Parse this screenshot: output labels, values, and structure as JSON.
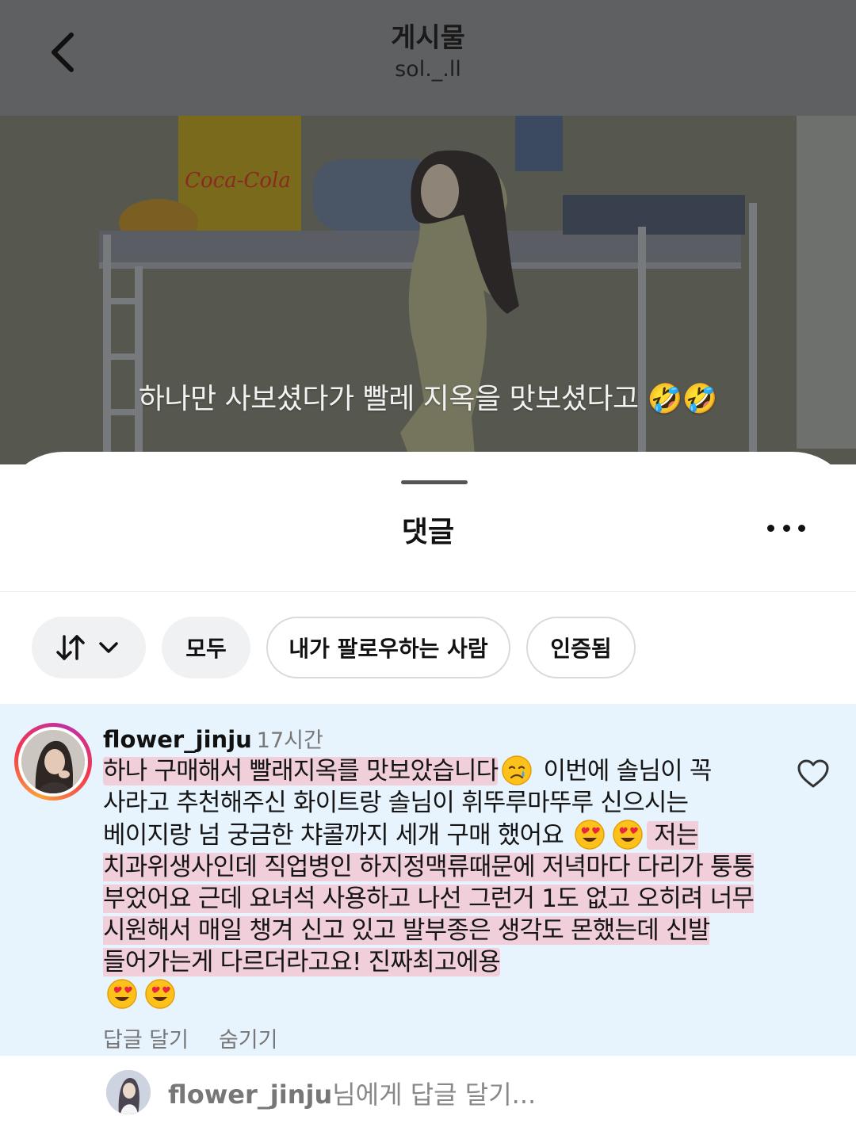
{
  "header": {
    "title": "게시물",
    "username": "sol._.ll"
  },
  "post": {
    "caption": "하나만 사보셨다가 빨레 지옥을 맛보셨다고 🤣🤣"
  },
  "sheet": {
    "title": "댓글"
  },
  "filters": {
    "all": "모두",
    "following": "내가 팔로우하는 사람",
    "verified": "인증됨"
  },
  "comment": {
    "username": "flower_jinju",
    "time": "17시간",
    "t1": "하나 구매해서 빨래지옥를 맛보았습니다",
    "t2": " 이번에 솔님이 꼭 사라고 추천해주신 화이트랑 솔님이 휘뚜루마뚜루 신으시는 베이지랑 넘 궁금한 챠콜까지 세개 구매 했어요 ",
    "t3": " 저는 치과위생사인데 직업병인 하지정맥류때문에 저녁마다 다리가 퉁퉁 부었어요 근데 요녀석 사용하고 나선 그런거 1도 없고 오히려 너무 시원해서 매일 챙겨 신고 있고 발부종은 생각도 몬했는데 신발 들어가는게 다르더라고요! 진짜최고에용",
    "reply_label": "답글 달기",
    "hide_label": "숨기기"
  },
  "reply_bar": {
    "target": "flower_jinju",
    "placeholder": "님에게 답글 달기..."
  },
  "colors": {
    "header_bg": "#5f6062",
    "highlight_bg": "#e7f3fd",
    "marker_pink": "#f8b0be",
    "story_ring": "#f0384f"
  }
}
